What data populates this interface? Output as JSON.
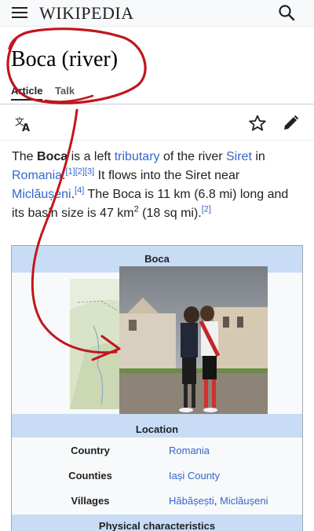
{
  "header": {
    "wordmark": "WIKIPEDIA",
    "menu_icon": "menu-icon",
    "search_icon": "search-icon"
  },
  "page": {
    "title": "Boca (river)",
    "tabs": [
      {
        "label": "Article"
      },
      {
        "label": "Talk"
      }
    ],
    "actions": {
      "translate_icon": "translate-icon",
      "watch_icon": "star-icon",
      "edit_icon": "pencil-icon"
    }
  },
  "lead": {
    "t1": "The ",
    "bold": "Boca",
    "t2": " is a left ",
    "link_tributary": "tributary",
    "t3": " of the river ",
    "link_siret": "Siret",
    "t4": " in ",
    "link_romania": "Romania",
    "t5": ".",
    "ref_1": "[1]",
    "ref_2": "[2]",
    "ref_3": "[3]",
    "t6": " It flows into the Siret near ",
    "link_miclauseni": "Miclăușeni",
    "t7": ".",
    "ref_4": "[4]",
    "t8": " The Boca is 11 km (6.8 mi) long and its basin size is 47 km",
    "sup2": "2",
    "t9": " (18 sq mi).",
    "ref_2b": "[2]"
  },
  "infobox": {
    "title": "Boca",
    "location_header": "Location",
    "rows": [
      {
        "label": "Country",
        "value": "Romania"
      },
      {
        "label": "Counties",
        "value": "Iași County"
      },
      {
        "label": "Villages",
        "value_a": "Hăbășești",
        "sep": ", ",
        "value_b": "Miclăușeni"
      }
    ],
    "physical_header": "Physical characteristics"
  },
  "colors": {
    "link": "#3366cc",
    "infobox_header": "#c8dcf5",
    "annotation": "#c0161e"
  }
}
